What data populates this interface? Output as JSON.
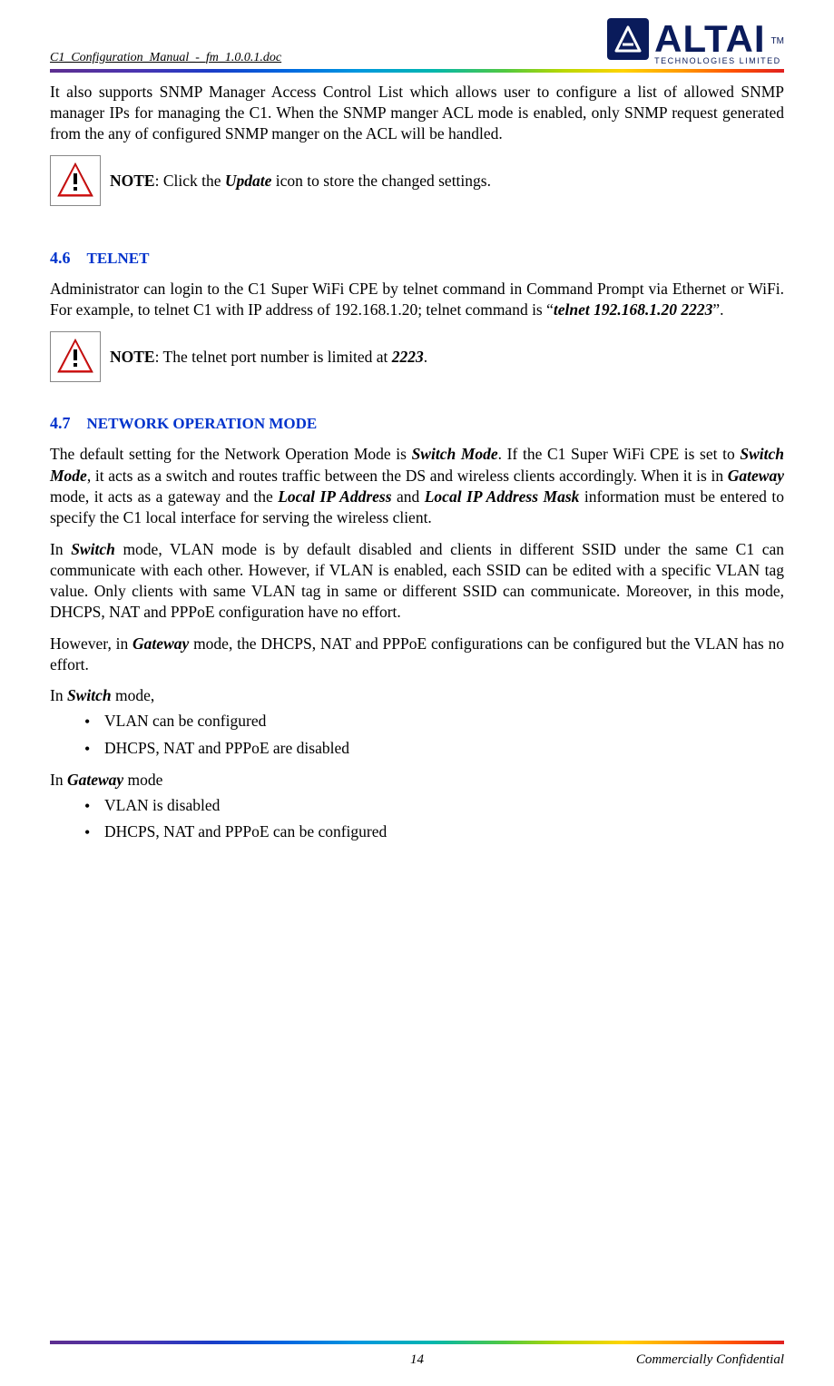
{
  "header": {
    "doc_title": "C1_Configuration_Manual_-_fm_1.0.0.1.doc",
    "logo_text": "ALTAI",
    "logo_tm": "TM",
    "tagline": "TECHNOLOGIES LIMITED"
  },
  "intro_para": "It also supports SNMP Manager Access Control List which allows user to configure a list of allowed SNMP manager IPs for managing the C1. When the SNMP manger ACL mode is enabled, only SNMP request generated from the any of configured SNMP manger on the ACL will be handled.",
  "note1": {
    "label": "NOTE",
    "before": ": Click the ",
    "bold": "Update",
    "after": " icon to store the changed settings."
  },
  "sec46": {
    "num": "4.6",
    "title": "TELNET",
    "p1_a": "Administrator can login to the C1 Super WiFi CPE by telnet command in Command Prompt via Ethernet or WiFi. For example, to telnet C1 with IP address of 192.168.1.20; telnet command is “",
    "p1_bold": "telnet 192.168.1.20 2223",
    "p1_b": "”.",
    "note": {
      "label": "NOTE",
      "before": ": The telnet port number is limited at ",
      "bold": "2223",
      "after": "."
    }
  },
  "sec47": {
    "num": "4.7",
    "title": "NETWORK OPERATION MODE",
    "p1_a": "The default setting for the Network Operation Mode is ",
    "p1_b1": "Switch Mode",
    "p1_c": ". If the C1 Super WiFi CPE is set to ",
    "p1_b2": "Switch Mode",
    "p1_d": ", it acts as a switch and routes traffic between the DS and wireless clients accordingly. When it is in ",
    "p1_b3": "Gateway",
    "p1_e": " mode, it acts as a gateway and the ",
    "p1_b4": "Local IP Address",
    "p1_f": " and ",
    "p1_b5": "Local IP Address Mask",
    "p1_g": " information must be entered to specify the C1 local interface for serving the wireless client.",
    "p2_a": "In ",
    "p2_b1": "Switch",
    "p2_c": " mode, VLAN mode is by default disabled and clients in different SSID under the same C1 can communicate with each other. However, if VLAN is enabled, each SSID can be edited with a specific VLAN tag value. Only clients with same VLAN tag in same or different SSID can communicate. Moreover, in this mode, DHCPS, NAT and PPPoE configuration have no effort.",
    "p3_a": "However, in ",
    "p3_b1": "Gateway",
    "p3_c": " mode, the DHCPS, NAT and PPPoE configurations can be configured but the VLAN has no effort.",
    "switch_line_a": "In ",
    "switch_line_b": "Switch",
    "switch_line_c": " mode,",
    "switch_bullets": [
      "VLAN can be configured",
      "DHCPS, NAT and PPPoE are disabled"
    ],
    "gw_line_a": "In ",
    "gw_line_b": "Gateway",
    "gw_line_c": " mode",
    "gw_bullets": [
      "VLAN is disabled",
      "DHCPS, NAT and PPPoE can be configured"
    ]
  },
  "footer": {
    "page": "14",
    "right": "Commercially Confidential"
  }
}
